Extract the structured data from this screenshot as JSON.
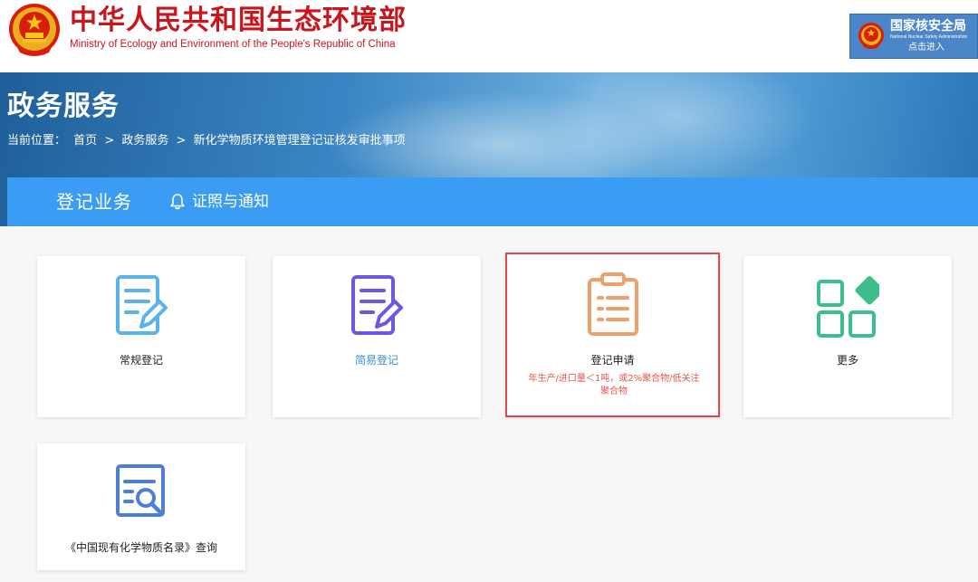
{
  "header": {
    "title": "中华人民共和国生态环境部",
    "subtitle": "Ministry of Ecology and Environment of the People's Republic of China",
    "nnsa": {
      "title": "国家核安全局",
      "subtitle_en": "National Nuclear Safety Administration",
      "enter": "点击进入"
    }
  },
  "banner": {
    "page_title": "政务服务",
    "breadcrumb_prefix": "当前位置：",
    "breadcrumb": [
      "首页",
      ">",
      "政务服务",
      ">",
      "新化学物质环境管理登记证核发审批事项"
    ]
  },
  "tabs": {
    "registration": "登记业务",
    "certificates": "证照与通知"
  },
  "cards": [
    {
      "label": "常规登记",
      "icon": "edit-document-icon",
      "color": "#5bb3e8"
    },
    {
      "label": "简易登记",
      "icon": "edit-document-icon",
      "color": "#6b5ae0",
      "label_color": "#3a8fd8"
    },
    {
      "label": "登记申请",
      "icon": "clipboard-icon",
      "color": "#eea06a",
      "note": "年生产/进口量＜1吨，或2%聚合物/低关注聚合物",
      "selected": true
    },
    {
      "label": "更多",
      "icon": "apps-grid-icon",
      "color": "#3cbf8a"
    },
    {
      "label": "《中国现有化学物质名录》查询",
      "icon": "search-document-icon",
      "color": "#4d7fd6"
    }
  ],
  "colors": {
    "brand_red": "#c8161d",
    "tab_blue": "#3a9cf2",
    "highlight_border": "#e04a4a",
    "note_red": "#e8564c"
  }
}
